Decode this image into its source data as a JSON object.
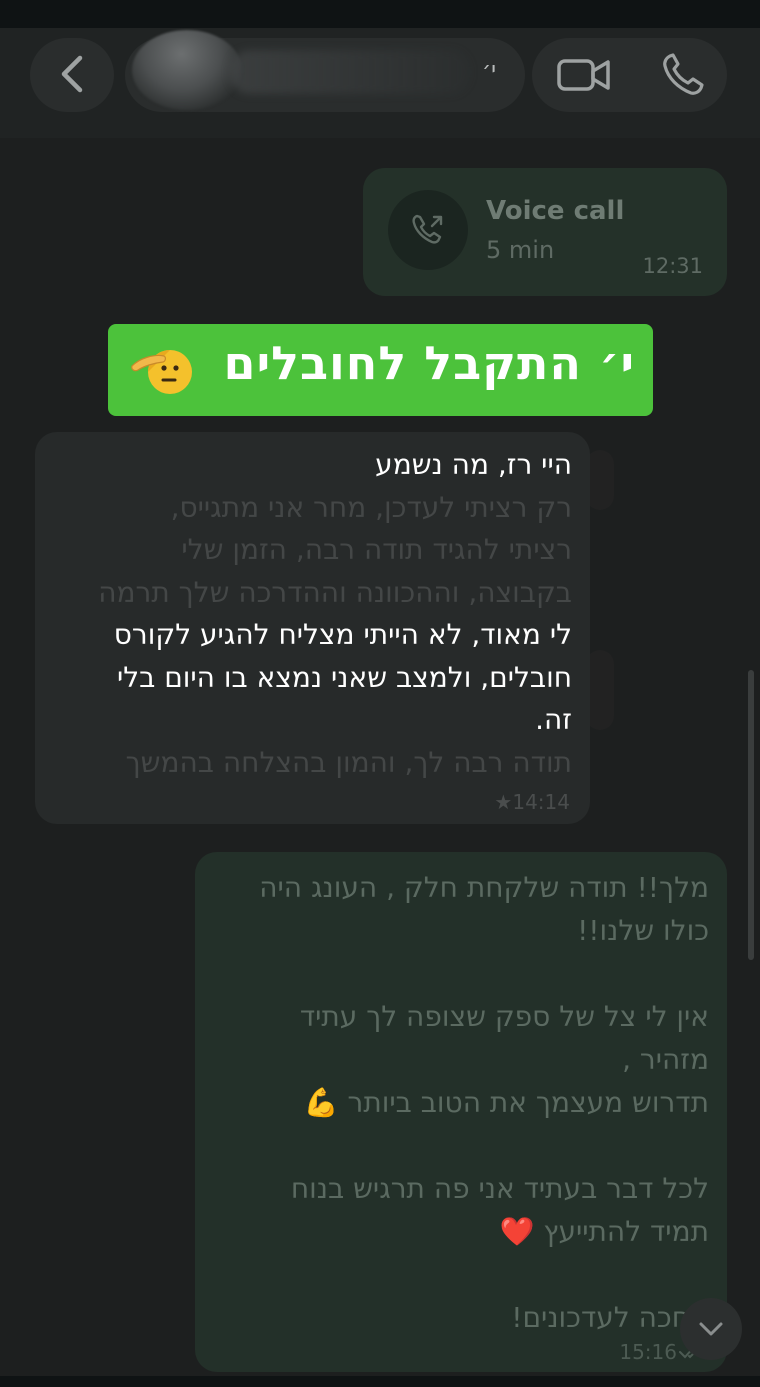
{
  "header": {
    "contact_suffix": "י׳",
    "back_icon": "chevron-left-icon",
    "video_icon": "video-camera-icon",
    "phone_icon": "phone-icon"
  },
  "voice_call": {
    "title": "Voice call",
    "duration": "5 min",
    "time": "12:31",
    "icon": "outgoing-call-icon"
  },
  "banner": {
    "text": "י׳ התקבל לחובלים",
    "emoji": "saluting-face-emoji",
    "color": "#4cc23b"
  },
  "incoming_message": {
    "lines": [
      "היי רז, מה נשמע",
      "רק רציתי לעדכן, מחר אני מתגייס,",
      "רציתי להגיד תודה רבה, הזמן שלי",
      "בקבוצה, וההכוונה וההדרכה שלך תרמה",
      "לי מאוד, לא הייתי מצליח להגיע לקורס",
      "חובלים, ולמצב שאני נמצא בו היום בלי",
      "זה.",
      "תודה רבה לך, והמון בהצלחה בהמשך"
    ],
    "time": "★14:14"
  },
  "outgoing_message": {
    "lines": [
      "מלך!! תודה שלקחת חלק , העונג היה",
      "כולו שלנו!!",
      "",
      "אין לי צל של ספק שצופה לך עתיד",
      "מזהיר ,",
      "תדרוש מעצמך את הטוב ביותר 💪",
      "",
      "לכל דבר בעתיד אני פה תרגיש בנוח",
      "תמיד להתייעץ ❤️",
      "",
      "מחכה לעדכונים!"
    ],
    "time": "15:16"
  },
  "scroll_down_icon": "chevron-down-icon"
}
